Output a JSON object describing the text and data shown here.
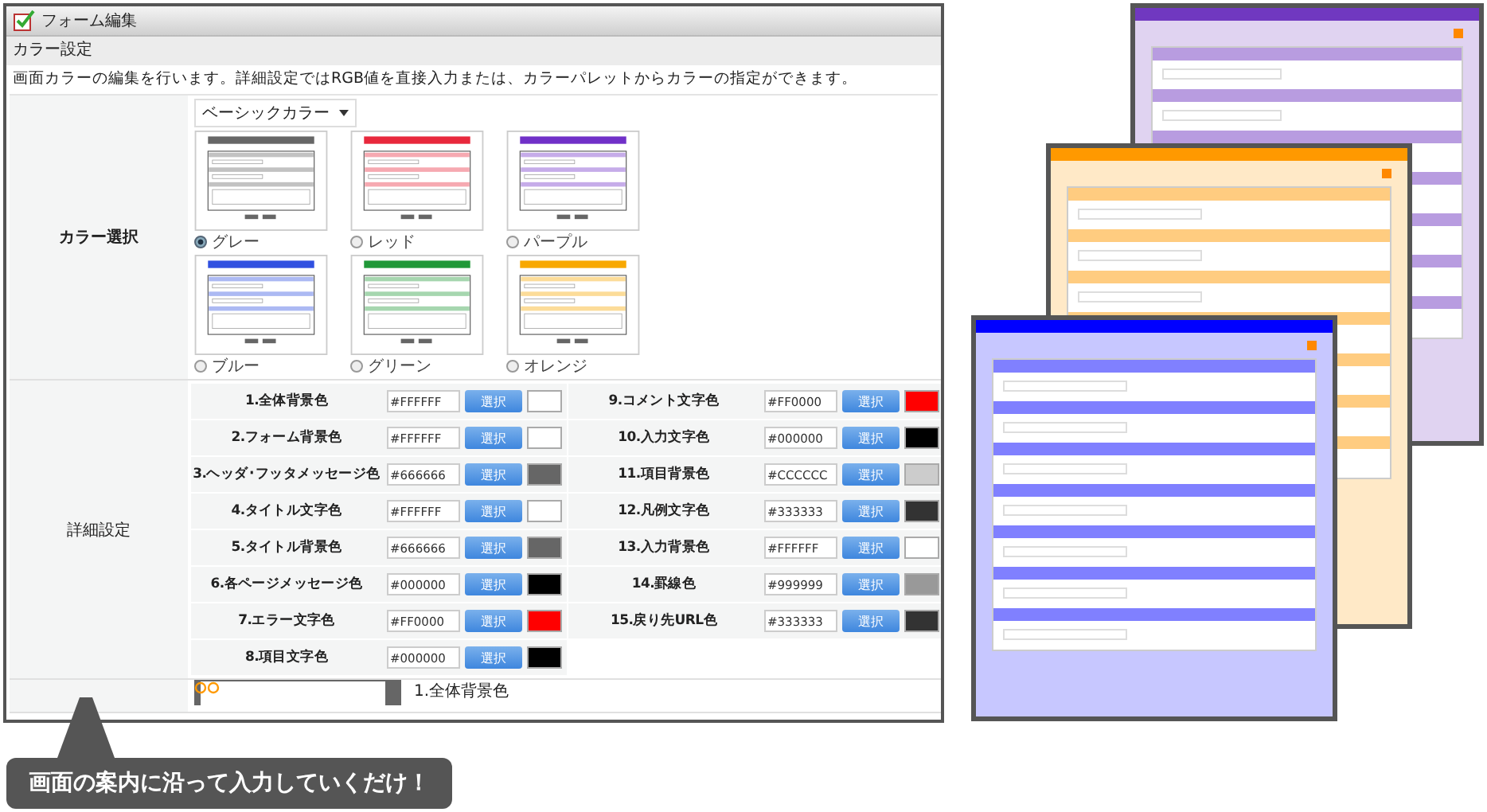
{
  "window": {
    "title": "フォーム編集"
  },
  "section": {
    "title": "カラー設定",
    "description": "画面カラーの編集を行います。詳細設定ではRGB値を直接入力または、カラーパレットからカラーの指定ができます。"
  },
  "color_select": {
    "label": "カラー選択",
    "preset": "ベーシックカラー",
    "themes": [
      {
        "name": "グレー",
        "color": "#666666",
        "selected": true
      },
      {
        "name": "レッド",
        "color": "#e8283c",
        "selected": false
      },
      {
        "name": "パープル",
        "color": "#7030c8",
        "selected": false
      },
      {
        "name": "ブルー",
        "color": "#3050e0",
        "selected": false
      },
      {
        "name": "グリーン",
        "color": "#209838",
        "selected": false
      },
      {
        "name": "オレンジ",
        "color": "#f8a800",
        "selected": false
      }
    ]
  },
  "details": {
    "label": "詳細設定",
    "items": [
      {
        "label": "1.全体背景色",
        "value": "#FFFFFF",
        "button": "選択",
        "color": "#ffffff"
      },
      {
        "label": "2.フォーム背景色",
        "value": "#FFFFFF",
        "button": "選択",
        "color": "#ffffff"
      },
      {
        "label": "3.ヘッダ･フッタメッセージ色",
        "value": "#666666",
        "button": "選択",
        "color": "#666666"
      },
      {
        "label": "4.タイトル文字色",
        "value": "#FFFFFF",
        "button": "選択",
        "color": "#ffffff"
      },
      {
        "label": "5.タイトル背景色",
        "value": "#666666",
        "button": "選択",
        "color": "#666666"
      },
      {
        "label": "6.各ページメッセージ色",
        "value": "#000000",
        "button": "選択",
        "color": "#000000"
      },
      {
        "label": "7.エラー文字色",
        "value": "#FF0000",
        "button": "選択",
        "color": "#ff0000"
      },
      {
        "label": "8.項目文字色",
        "value": "#000000",
        "button": "選択",
        "color": "#000000"
      },
      {
        "label": "9.コメント文字色",
        "value": "#FF0000",
        "button": "選択",
        "color": "#ff0000"
      },
      {
        "label": "10.入力文字色",
        "value": "#000000",
        "button": "選択",
        "color": "#000000"
      },
      {
        "label": "11.項目背景色",
        "value": "#CCCCCC",
        "button": "選択",
        "color": "#cccccc"
      },
      {
        "label": "12.凡例文字色",
        "value": "#333333",
        "button": "選択",
        "color": "#333333"
      },
      {
        "label": "13.入力背景色",
        "value": "#FFFFFF",
        "button": "選択",
        "color": "#ffffff"
      },
      {
        "label": "14.罫線色",
        "value": "#999999",
        "button": "選択",
        "color": "#999999"
      },
      {
        "label": "15.戻り先URL色",
        "value": "#333333",
        "button": "選択",
        "color": "#333333"
      }
    ]
  },
  "preview_row": {
    "label": "1.全体背景色"
  },
  "callout": "画面の案内に沿って入力していくだけ！",
  "previews": [
    {
      "color": "#7038c0"
    },
    {
      "color": "#ff9900"
    },
    {
      "color": "#0000ff"
    }
  ]
}
